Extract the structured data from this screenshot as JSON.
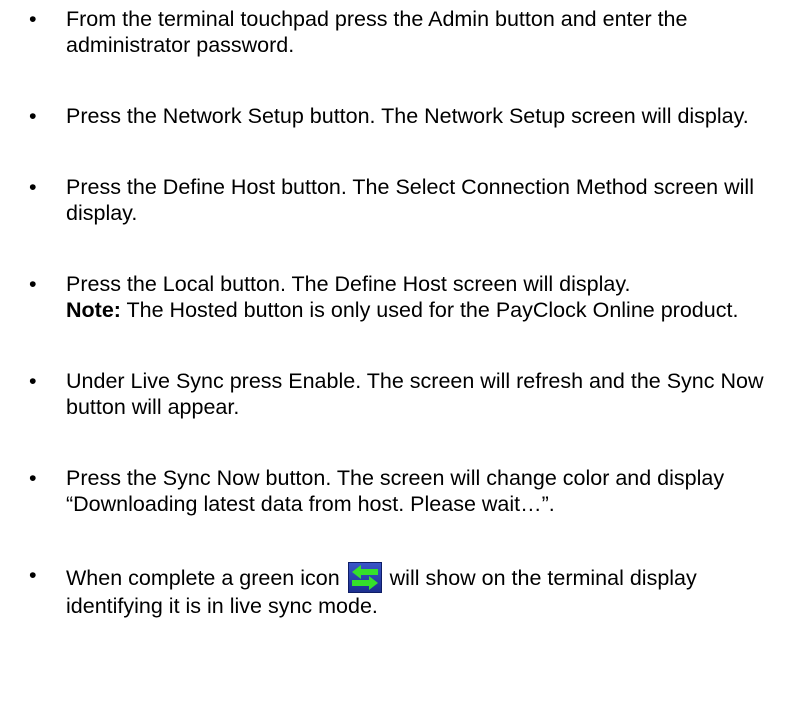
{
  "bullet": "•",
  "items": [
    {
      "text": "From the terminal touchpad press the Admin button and enter the administrator password."
    },
    {
      "text": "Press the Network Setup button. The Network Setup screen will display."
    },
    {
      "text": "Press the Define Host button. The Select Connection Method screen will display."
    },
    {
      "text": "Press the Local button. The Define Host screen will display.",
      "note_label": "Note:",
      "note_text": " The Hosted button is only used for the PayClock Online product."
    },
    {
      "text": "Under Live Sync press Enable. The screen will refresh and the Sync Now button will appear."
    },
    {
      "text": "Press the Sync Now button. The screen will change color and display “Downloading latest data from host. Please wait…”."
    },
    {
      "text_before": "When complete a green icon",
      "icon": "live-sync-arrows-icon",
      "text_after": "will show on the terminal display identifying it is in live sync mode."
    }
  ],
  "colors": {
    "icon_background": "#2b45b5",
    "icon_arrows": "#35e02a"
  }
}
